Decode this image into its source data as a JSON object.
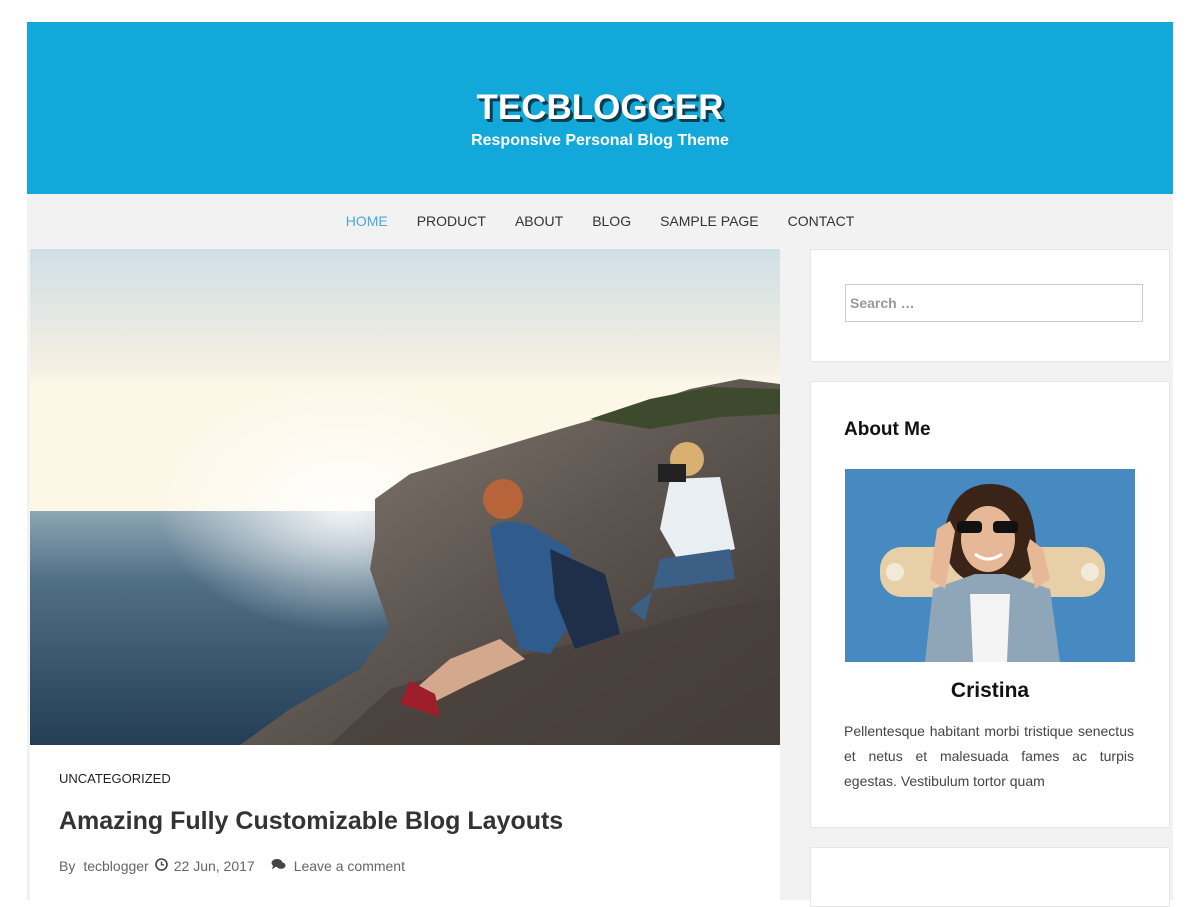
{
  "header": {
    "title": "TECBLOGGER",
    "tagline": "Responsive Personal Blog Theme",
    "bg_color": "#12a8d9"
  },
  "nav": {
    "items": [
      {
        "label": "HOME",
        "active": true
      },
      {
        "label": "PRODUCT",
        "active": false
      },
      {
        "label": "ABOUT",
        "active": false
      },
      {
        "label": "BLOG",
        "active": false
      },
      {
        "label": "SAMPLE PAGE",
        "active": false
      },
      {
        "label": "CONTACT",
        "active": false
      }
    ],
    "active_color": "#4aa7e0"
  },
  "post": {
    "image_icon": "featured-photo",
    "category": "UNCATEGORIZED",
    "title": "Amazing Fully Customizable Blog Layouts",
    "meta": {
      "by_label": "By",
      "author": "tecblogger",
      "date_icon": "clock-icon",
      "date": "22 Jun, 2017",
      "comment_icon": "comments-icon",
      "comment_link": "Leave a comment"
    }
  },
  "sidebar": {
    "search": {
      "placeholder": "Search …"
    },
    "about": {
      "title": "About Me",
      "photo_icon": "profile-photo",
      "name": "Cristina",
      "text": "Pellentesque habitant morbi tristique senectus et netus et malesuada fames ac turpis egestas. Vestibulum tortor quam"
    }
  }
}
